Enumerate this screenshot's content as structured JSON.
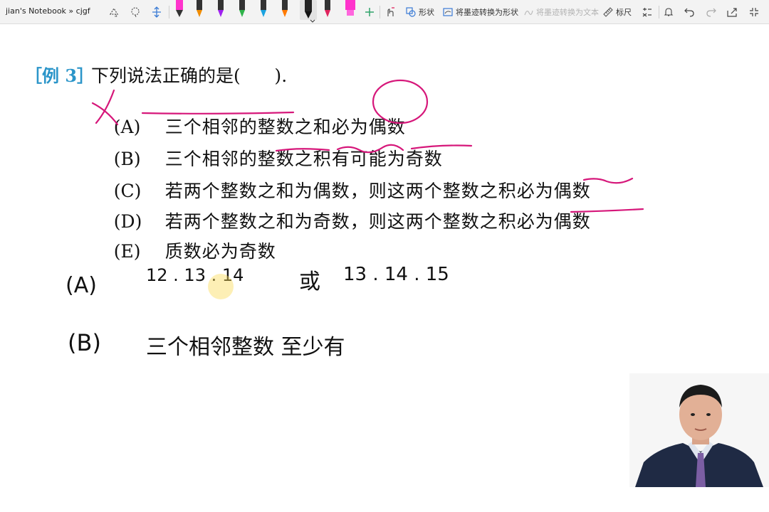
{
  "window": {
    "title": "jian's Notebook » cjgf"
  },
  "toolbar": {
    "shape_label": "形状",
    "ink_to_shape_label": "将墨迹转换为形状",
    "ink_to_text_label": "将墨迹转换为文本",
    "ruler_label": "标尺",
    "pens": [
      {
        "name": "pen-black",
        "color": "#111111"
      },
      {
        "name": "pen-orange",
        "color": "#f08c00"
      },
      {
        "name": "pen-purple",
        "color": "#a020f0"
      },
      {
        "name": "pen-green",
        "color": "#2fb34a"
      },
      {
        "name": "pen-cyan",
        "color": "#1aa3e0"
      },
      {
        "name": "pen-orange-2",
        "color": "#ff7a00"
      },
      {
        "name": "pen-black-selected",
        "color": "#111111"
      },
      {
        "name": "pen-red",
        "color": "#e0245e"
      },
      {
        "name": "highlighter-magenta",
        "color": "#ff33cc"
      }
    ],
    "icons": [
      "lasso-select-icon",
      "eraser-icon",
      "add-space-icon",
      "add-pen-icon",
      "touch-draw-icon",
      "replay-icon",
      "undo-icon",
      "redo-icon",
      "share-icon",
      "fullscreen-icon",
      "notification-icon",
      "math-icon"
    ]
  },
  "content": {
    "example_label": "［例 3］",
    "question_stem": "下列说法正确的是(      ).",
    "options": [
      {
        "label": "(A)",
        "text": "三个相邻的整数之和必为偶数"
      },
      {
        "label": "(B)",
        "text": "三个相邻的整数之积有可能为奇数"
      },
      {
        "label": "(C)",
        "text": "若两个整数之和为偶数，则这两个整数之积必为偶数"
      },
      {
        "label": "(D)",
        "text": "若两个整数之和为奇数，则这两个整数之积必为偶数"
      },
      {
        "label": "(E)",
        "text": "质数必为奇数"
      }
    ],
    "handwriting": {
      "a_label": "(A)",
      "a_numbers_1": "12 . 13 . 14",
      "a_or": "或",
      "a_numbers_2": "13 . 14 . 15",
      "b_label": "(B)",
      "b_note": "三个相邻整数 至少有"
    },
    "annotation_color": "#d6177a"
  },
  "video": {
    "description_icon": "instructor-video"
  }
}
